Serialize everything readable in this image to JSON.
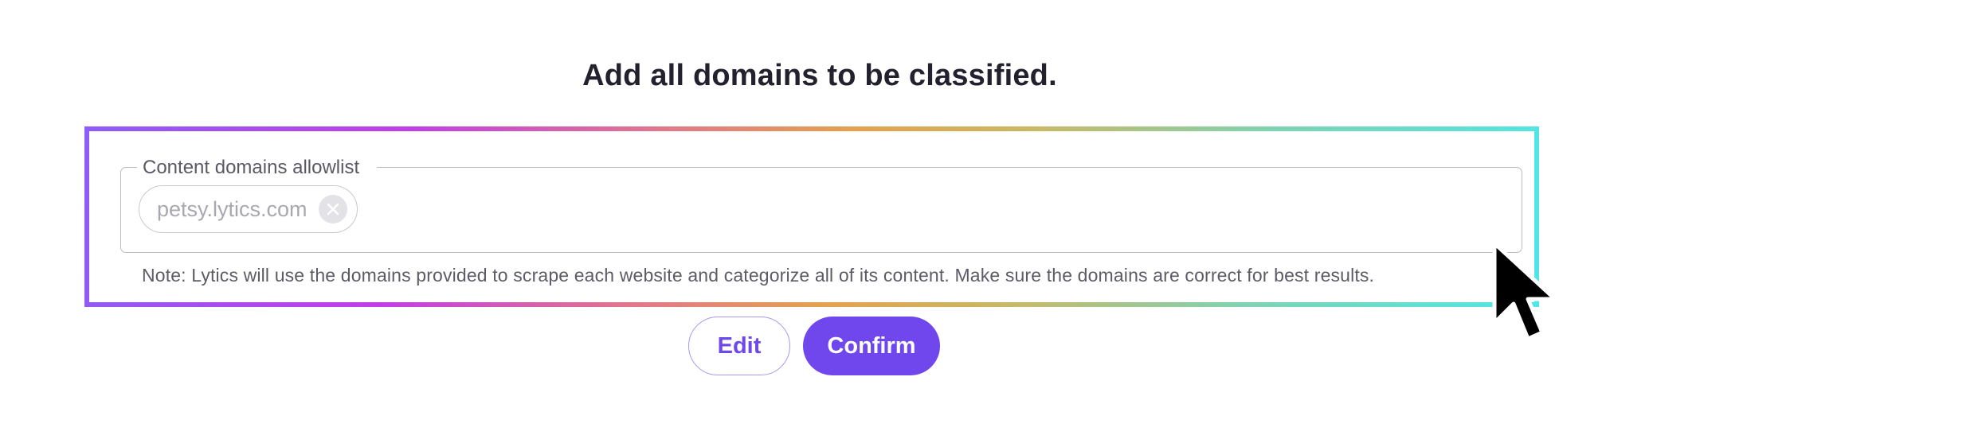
{
  "heading": "Add all domains to be classified.",
  "allowlist": {
    "label": "Content domains allowlist",
    "chips": [
      {
        "label": "petsy.lytics.com",
        "remove_icon": "close-circle-icon"
      }
    ],
    "note": "Note: Lytics will use the domains provided to scrape each website and categorize all of its content. Make sure the domains are correct for best results."
  },
  "actions": {
    "edit_label": "Edit",
    "confirm_label": "Confirm"
  },
  "colors": {
    "accent": "#6f47ec",
    "title": "#23212e",
    "gradient": [
      "#8e5cf6",
      "#c13ee6",
      "#e0748f",
      "#e4a24d",
      "#c9b866",
      "#7fd3b1",
      "#4fe6e9"
    ]
  },
  "icons": {
    "pointer": "mouse-pointer-icon"
  }
}
